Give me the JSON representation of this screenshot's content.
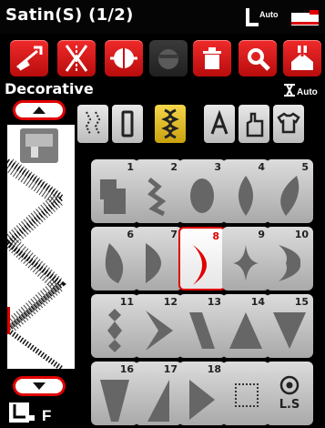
{
  "window": {
    "title": "Satin(S) (1/2)"
  },
  "header": {
    "auto_label": "Auto"
  },
  "section": {
    "title": "Decorative",
    "auto_label": "Auto"
  },
  "toolbar": [
    "mirror",
    "needle-position",
    "stitch-length",
    "memory",
    "delete",
    "zoom",
    "save"
  ],
  "categories": [
    {
      "name": "utility"
    },
    {
      "name": "buttonhole"
    },
    {
      "name": "decorative",
      "selected": true
    },
    {
      "name": "alphabet"
    },
    {
      "name": "hand-stitch"
    },
    {
      "name": "clothing"
    }
  ],
  "stitches": [
    {
      "num": "1"
    },
    {
      "num": "2"
    },
    {
      "num": "3"
    },
    {
      "num": "4"
    },
    {
      "num": "5"
    },
    {
      "num": "6"
    },
    {
      "num": "7"
    },
    {
      "num": "8",
      "selected": true
    },
    {
      "num": "9"
    },
    {
      "num": "10"
    },
    {
      "num": "11"
    },
    {
      "num": "12"
    },
    {
      "num": "13"
    },
    {
      "num": "14"
    },
    {
      "num": "15"
    },
    {
      "num": "16"
    },
    {
      "num": "17"
    },
    {
      "num": "18"
    }
  ],
  "ls_label": "L.S",
  "presser_foot": {
    "label": "F"
  },
  "colors": {
    "accent": "#e00000",
    "selected_category": "#e0b820"
  }
}
